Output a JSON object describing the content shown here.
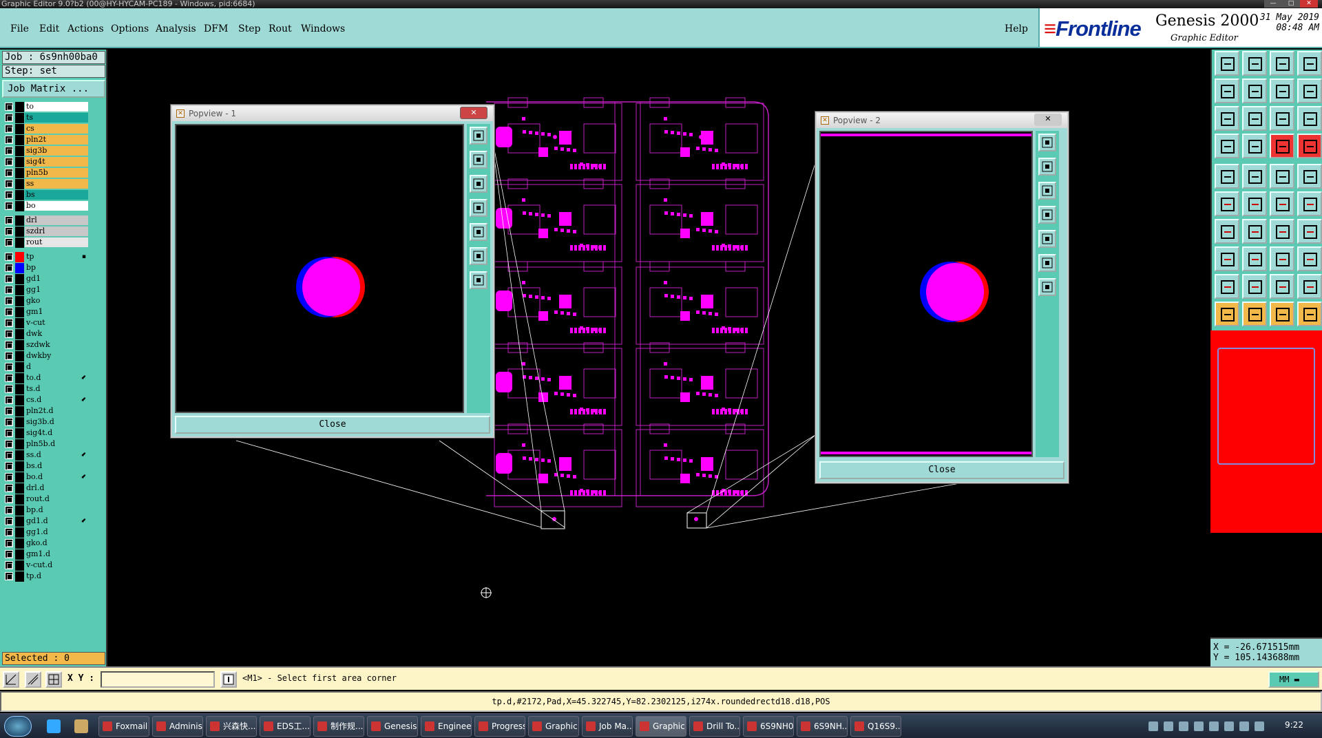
{
  "window_title": "Graphic Editor 9.0?b2 (00@HY-HYCAM-PC189 - Windows, pid:6684)",
  "menu": [
    "File",
    "Edit",
    "Actions",
    "Options",
    "Analysis",
    "DFM",
    "Step",
    "Rout",
    "Windows"
  ],
  "help": "Help",
  "brand": {
    "logo": "Frontline",
    "product": "Genesis 2000",
    "subtitle": "Graphic Editor",
    "date": "31 May 2019",
    "time": "08:48 AM"
  },
  "job": {
    "job_line": "Job : 6s9nh00ba0",
    "step_line": "Step: set",
    "matrix_button": "Job Matrix ..."
  },
  "layers_board": [
    {
      "name": "to",
      "color": "#ffffff"
    },
    {
      "name": "ts",
      "color": "#1aa89a"
    },
    {
      "name": "cs",
      "color": "#f3b84a"
    },
    {
      "name": "pln2t",
      "color": "#f3b84a"
    },
    {
      "name": "sig3b",
      "color": "#f3b84a"
    },
    {
      "name": "sig4t",
      "color": "#f3b84a"
    },
    {
      "name": "pln5b",
      "color": "#f3b84a"
    },
    {
      "name": "ss",
      "color": "#f3b84a"
    },
    {
      "name": "bs",
      "color": "#1aa89a"
    },
    {
      "name": "bo",
      "color": "#ffffff"
    }
  ],
  "layers_drill": [
    {
      "name": "drl",
      "color": "#c8c8c8"
    },
    {
      "name": "szdrl",
      "color": "#c8c8c8"
    },
    {
      "name": "rout",
      "color": "#e6e6e6"
    }
  ],
  "layers_misc": [
    {
      "name": "tp",
      "color": "#5bcab2",
      "swatch": "#ff0000",
      "mark": "▪"
    },
    {
      "name": "bp",
      "color": "#5bcab2",
      "swatch": "#0000ff",
      "mark": ""
    },
    {
      "name": "gd1",
      "color": "#5bcab2",
      "mark": ""
    },
    {
      "name": "gg1",
      "color": "#5bcab2",
      "mark": ""
    },
    {
      "name": "gko",
      "color": "#5bcab2",
      "mark": ""
    },
    {
      "name": "gm1",
      "color": "#5bcab2",
      "mark": ""
    },
    {
      "name": "v-cut",
      "color": "#5bcab2",
      "mark": ""
    },
    {
      "name": "dwk",
      "color": "#5bcab2",
      "mark": ""
    },
    {
      "name": "szdwk",
      "color": "#5bcab2",
      "mark": ""
    },
    {
      "name": "dwkby",
      "color": "#5bcab2",
      "mark": ""
    },
    {
      "name": "d",
      "color": "#5bcab2",
      "mark": ""
    },
    {
      "name": "to.d",
      "color": "#5bcab2",
      "mark": "⬋"
    },
    {
      "name": "ts.d",
      "color": "#5bcab2",
      "mark": ""
    },
    {
      "name": "cs.d",
      "color": "#5bcab2",
      "mark": "⬋"
    },
    {
      "name": "pln2t.d",
      "color": "#5bcab2",
      "mark": ""
    },
    {
      "name": "sig3b.d",
      "color": "#5bcab2",
      "mark": ""
    },
    {
      "name": "sig4t.d",
      "color": "#5bcab2",
      "mark": ""
    },
    {
      "name": "pln5b.d",
      "color": "#5bcab2",
      "mark": ""
    },
    {
      "name": "ss.d",
      "color": "#5bcab2",
      "mark": "⬋"
    },
    {
      "name": "bs.d",
      "color": "#5bcab2",
      "mark": ""
    },
    {
      "name": "bo.d",
      "color": "#5bcab2",
      "mark": "⬋"
    },
    {
      "name": "drl.d",
      "color": "#5bcab2",
      "mark": ""
    },
    {
      "name": "rout.d",
      "color": "#5bcab2",
      "mark": ""
    },
    {
      "name": "bp.d",
      "color": "#5bcab2",
      "mark": ""
    },
    {
      "name": "gd1.d",
      "color": "#5bcab2",
      "mark": "⬋"
    },
    {
      "name": "gg1.d",
      "color": "#5bcab2",
      "mark": ""
    },
    {
      "name": "gko.d",
      "color": "#5bcab2",
      "mark": ""
    },
    {
      "name": "gm1.d",
      "color": "#5bcab2",
      "mark": ""
    },
    {
      "name": "v-cut.d",
      "color": "#5bcab2",
      "mark": ""
    },
    {
      "name": "tp.d",
      "color": "#5bcab2",
      "mark": ""
    }
  ],
  "selected": "Selected : 0",
  "popview1": {
    "title": "Popview - 1",
    "close": "Close"
  },
  "popview2": {
    "title": "Popview - 2",
    "close": "Close"
  },
  "coords": {
    "x": "X = -26.671515mm",
    "y": "Y = 105.143688mm"
  },
  "cmd": {
    "xy_label": "X Y :",
    "xy_value": "",
    "prompt": "<M1> - Select first area corner",
    "units": "MM"
  },
  "status": "tp.d,#2172,Pad,X=45.322745,Y=82.2302125,i274x.roundedrectd18.d18,POS",
  "taskbar": {
    "items": [
      "Foxmail",
      "Adminis...",
      "兴森快...",
      "EDS工...",
      "制作规...",
      "Genesis",
      "Enginee...",
      "Progress",
      "Graphic...",
      "Job Ma...",
      "Graphic...",
      "Drill To...",
      "6S9NH0...",
      "6S9NH...",
      "Q16S9..."
    ],
    "clock": "9:22"
  },
  "colors": {
    "pad": "#ff00ff",
    "menu_bg": "#9fdad6",
    "panel_bg": "#5bcab2",
    "cmd_bg": "#fdf5c8"
  }
}
